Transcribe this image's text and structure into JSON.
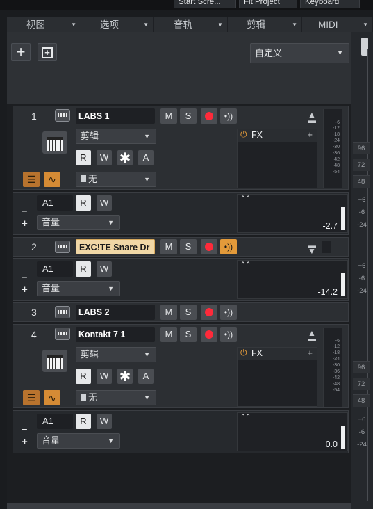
{
  "topbar": {
    "buttons": [
      "Start  Scre...",
      "Fit Project",
      "Keyboard"
    ]
  },
  "menubar": {
    "items": [
      "视图",
      "选项",
      "音轨",
      "剪辑",
      "MIDI"
    ]
  },
  "toolbar": {
    "add_icon": "plus-icon",
    "add_group_icon": "add-group-icon",
    "preset_value": "自定义"
  },
  "tracks": [
    {
      "number": "1",
      "name": "LABS 1",
      "expanded": true,
      "edit_mode": "剪辑",
      "input": "无",
      "fx_label": "FX",
      "meter_ticks": [
        "-6",
        "-12",
        "-18",
        "-24",
        "-30",
        "-36",
        "-42",
        "-48",
        "-54"
      ],
      "lane": {
        "name": "A1",
        "param": "音量",
        "value": "-2.7",
        "level": 0.55
      }
    },
    {
      "number": "2",
      "name": "EXC!TE Snare Dr",
      "selected": true,
      "expanded": false,
      "lane": {
        "name": "A1",
        "param": "音量",
        "value": "-14.2",
        "level": 0.55
      }
    },
    {
      "number": "3",
      "name": "LABS 2",
      "expanded": false
    },
    {
      "number": "4",
      "name": "Kontakt 7 1",
      "expanded": true,
      "edit_mode": "剪辑",
      "input": "无",
      "fx_label": "FX",
      "meter_ticks": [
        "-6",
        "-12",
        "-18",
        "-24",
        "-30",
        "-36",
        "-42",
        "-48",
        "-54"
      ],
      "lane": {
        "name": "A1",
        "param": "音量",
        "value": "0.0",
        "level": 0.55
      }
    }
  ],
  "buttons": {
    "mute": "M",
    "solo": "S",
    "read": "R",
    "write": "W",
    "star": "✱",
    "auto": "A"
  },
  "right_scale": {
    "group1": [
      "96",
      "72",
      "48"
    ],
    "lane_scale": [
      "+6",
      "-6",
      "-24"
    ]
  },
  "colors": {
    "accent": "#e39a3a",
    "record": "#ff2a3a",
    "selected_name": "#f0d7a6"
  }
}
